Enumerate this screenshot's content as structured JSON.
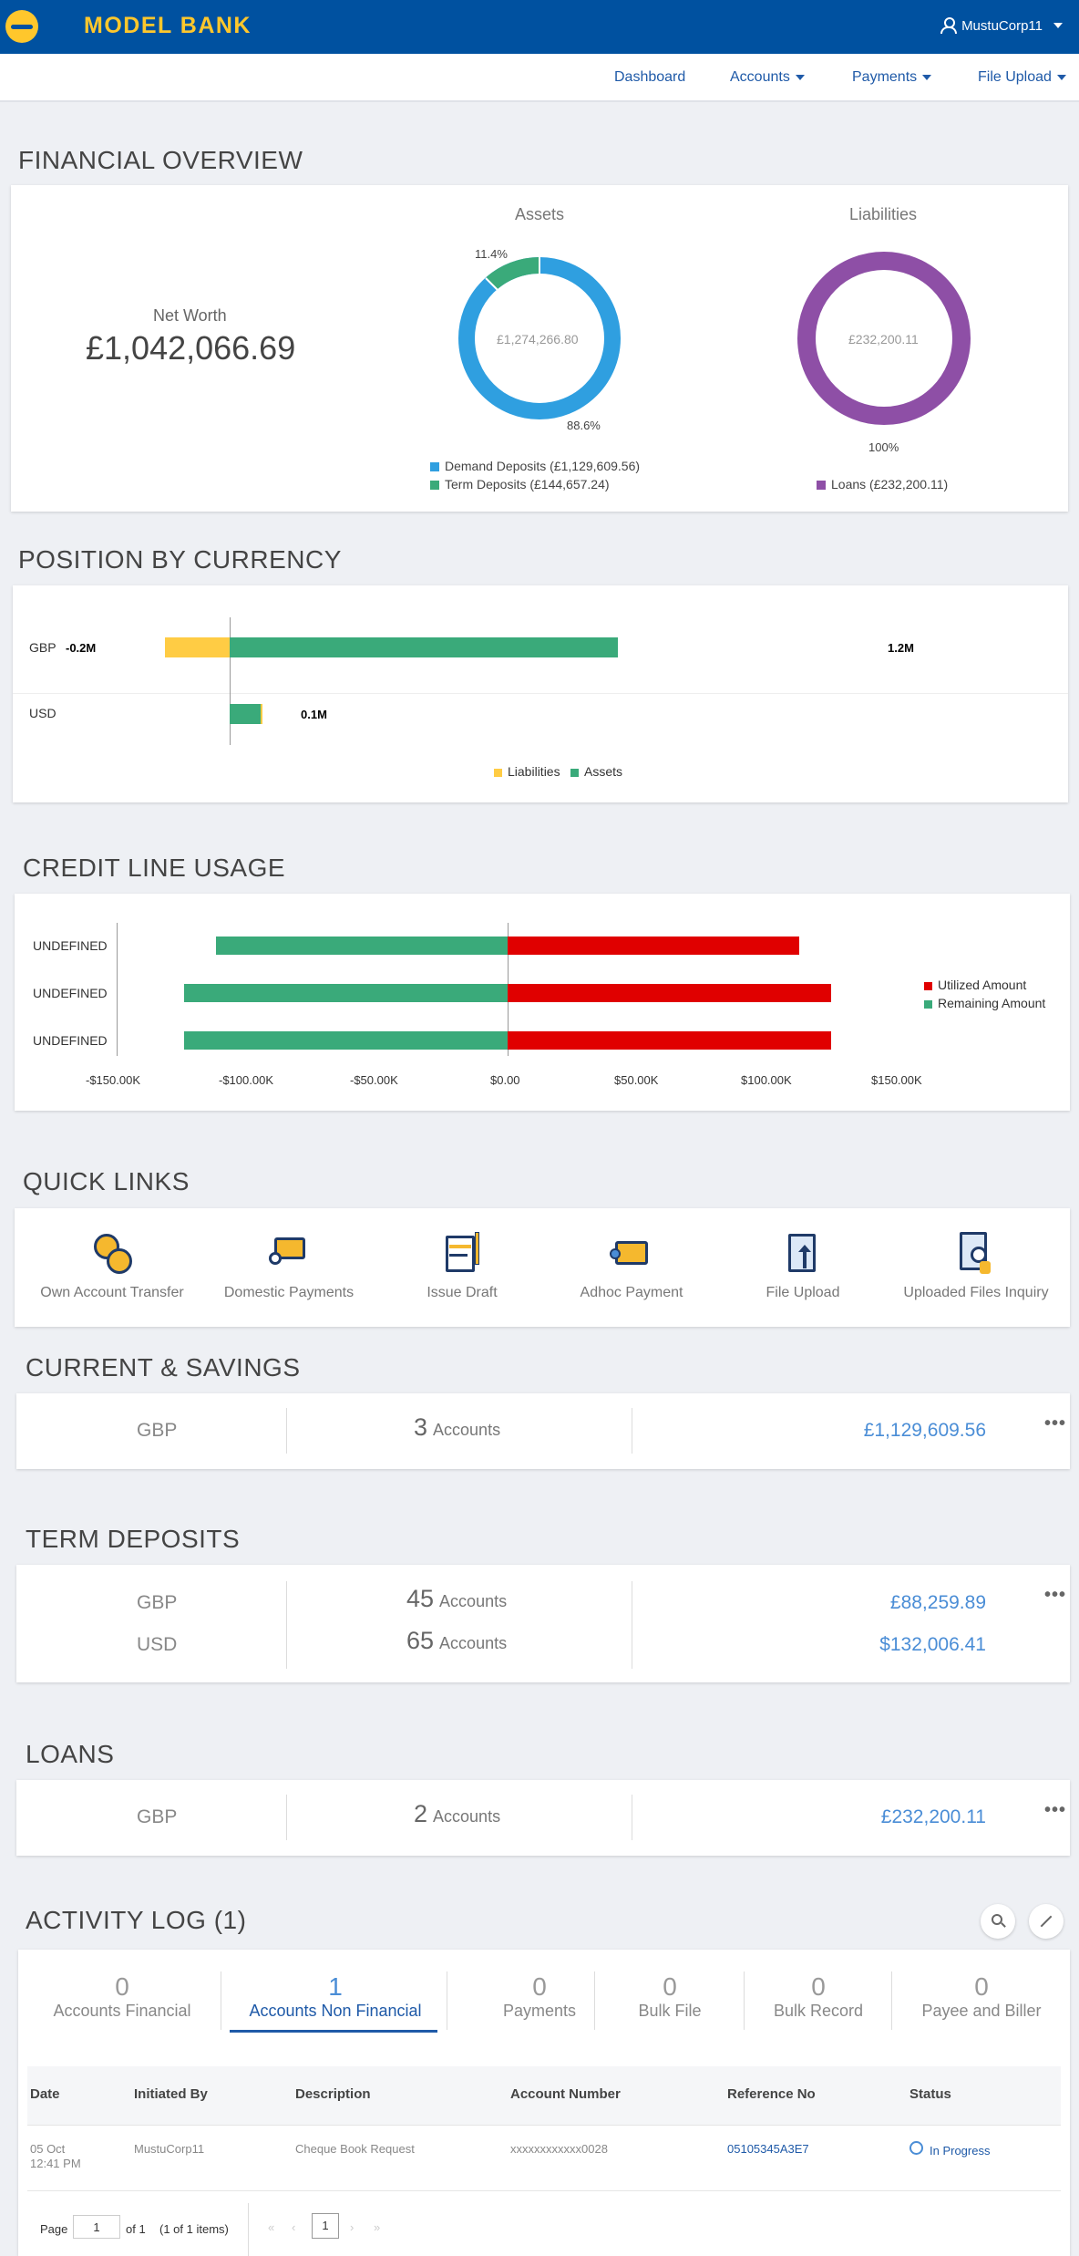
{
  "header": {
    "brand": "MODEL BANK",
    "user": "MustuCorp11"
  },
  "nav": {
    "items": [
      {
        "label": "Dashboard"
      },
      {
        "label": "Accounts"
      },
      {
        "label": "Payments"
      },
      {
        "label": "File Upload"
      }
    ]
  },
  "overview": {
    "title": "FINANCIAL OVERVIEW",
    "net_worth_label": "Net Worth",
    "net_worth_value": "£1,042,066.69",
    "assets": {
      "title": "Assets",
      "center": "£1,274,266.80",
      "pct_small": "11.4%",
      "pct_large": "88.6%",
      "legend": [
        "Demand Deposits (£1,129,609.56)",
        "Term Deposits (£144,657.24)"
      ],
      "colors": [
        "#2f9fe0",
        "#3aaa7a"
      ],
      "shares": [
        88.6,
        11.4
      ]
    },
    "liabilities": {
      "title": "Liabilities",
      "center": "£232,200.11",
      "pct": "100%",
      "legend": [
        "Loans (£232,200.11)"
      ],
      "colors": [
        "#8e4fa6"
      ]
    }
  },
  "position": {
    "title": "POSITION BY CURRENCY",
    "rows": [
      {
        "currency": "GBP",
        "neg_label": "-0.2M",
        "pos_label": "1.2M"
      },
      {
        "currency": "USD",
        "neg_label": "",
        "pos_label": "0.1M"
      }
    ],
    "legend": [
      "Liabilities",
      "Assets"
    ],
    "colors": {
      "liabilities": "#ffcc44",
      "assets": "#3aaa7a"
    }
  },
  "credit": {
    "title": "CREDIT LINE USAGE",
    "rows": [
      "UNDEFINED",
      "UNDEFINED",
      "UNDEFINED"
    ],
    "ticks": [
      "-$150.00K",
      "-$100.00K",
      "-$50.00K",
      "$0.00",
      "$50.00K",
      "$100.00K",
      "$150.00K"
    ],
    "legend": [
      "Utilized Amount",
      "Remaining Amount"
    ],
    "colors": {
      "utilized": "#e00000",
      "remaining": "#3aaa7a"
    }
  },
  "chart_data": [
    {
      "type": "bar",
      "categories": [
        "GBP",
        "USD"
      ],
      "series": [
        {
          "name": "Liabilities",
          "values": [
            -0.2,
            0
          ]
        },
        {
          "name": "Assets",
          "values": [
            1.2,
            0.1
          ]
        }
      ],
      "xlim": [
        -0.24,
        1.24
      ]
    },
    {
      "type": "bar",
      "categories": [
        "UNDEFINED",
        "UNDEFINED",
        "UNDEFINED"
      ],
      "series": [
        {
          "name": "Utilized Amount",
          "values": [
            112,
            124,
            124
          ]
        },
        {
          "name": "Remaining Amount",
          "values": [
            -112,
            -124,
            -124
          ]
        }
      ],
      "xlim": [
        -150,
        150
      ]
    }
  ],
  "quick_links": {
    "title": "QUICK LINKS",
    "items": [
      {
        "label": "Own Account Transfer",
        "icon": "coins-transfer-icon"
      },
      {
        "label": "Domestic Payments",
        "icon": "wallet-person-icon"
      },
      {
        "label": "Issue Draft",
        "icon": "draft-pen-icon"
      },
      {
        "label": "Adhoc Payment",
        "icon": "wallet-icon"
      },
      {
        "label": "File Upload",
        "icon": "file-upload-icon"
      },
      {
        "label": "Uploaded Files Inquiry",
        "icon": "file-inquiry-icon"
      }
    ]
  },
  "current_savings": {
    "title": "CURRENT & SAVINGS",
    "rows": [
      {
        "currency": "GBP",
        "count": "3",
        "count_label": "Accounts",
        "amount": "£1,129,609.56"
      }
    ]
  },
  "term_deposits": {
    "title": "TERM DEPOSITS",
    "rows": [
      {
        "currency": "GBP",
        "count": "45",
        "count_label": "Accounts",
        "amount": "£88,259.89"
      },
      {
        "currency": "USD",
        "count": "65",
        "count_label": "Accounts",
        "amount": "$132,006.41"
      }
    ]
  },
  "loans": {
    "title": "LOANS",
    "rows": [
      {
        "currency": "GBP",
        "count": "2",
        "count_label": "Accounts",
        "amount": "£232,200.11"
      }
    ]
  },
  "activity": {
    "title": "ACTIVITY LOG (1)",
    "tabs": [
      {
        "count": "0",
        "label": "Accounts Financial"
      },
      {
        "count": "1",
        "label": "Accounts Non Financial"
      },
      {
        "count": "0",
        "label": "Payments"
      },
      {
        "count": "0",
        "label": "Bulk File"
      },
      {
        "count": "0",
        "label": "Bulk Record"
      },
      {
        "count": "0",
        "label": "Payee and Biller"
      }
    ],
    "columns": [
      "Date",
      "Initiated By",
      "Description",
      "Account Number",
      "Reference No",
      "Status"
    ],
    "rows": [
      {
        "date": "05 Oct",
        "time": "12:41 PM",
        "initiated_by": "MustuCorp11",
        "description": "Cheque Book Request",
        "account": "xxxxxxxxxxxx0028",
        "reference": "05105345A3E7",
        "status": "In Progress"
      }
    ],
    "pager": {
      "page_label": "Page",
      "page_value": "1",
      "of": "of 1",
      "items": "(1 of 1 items)",
      "current": "1"
    }
  }
}
